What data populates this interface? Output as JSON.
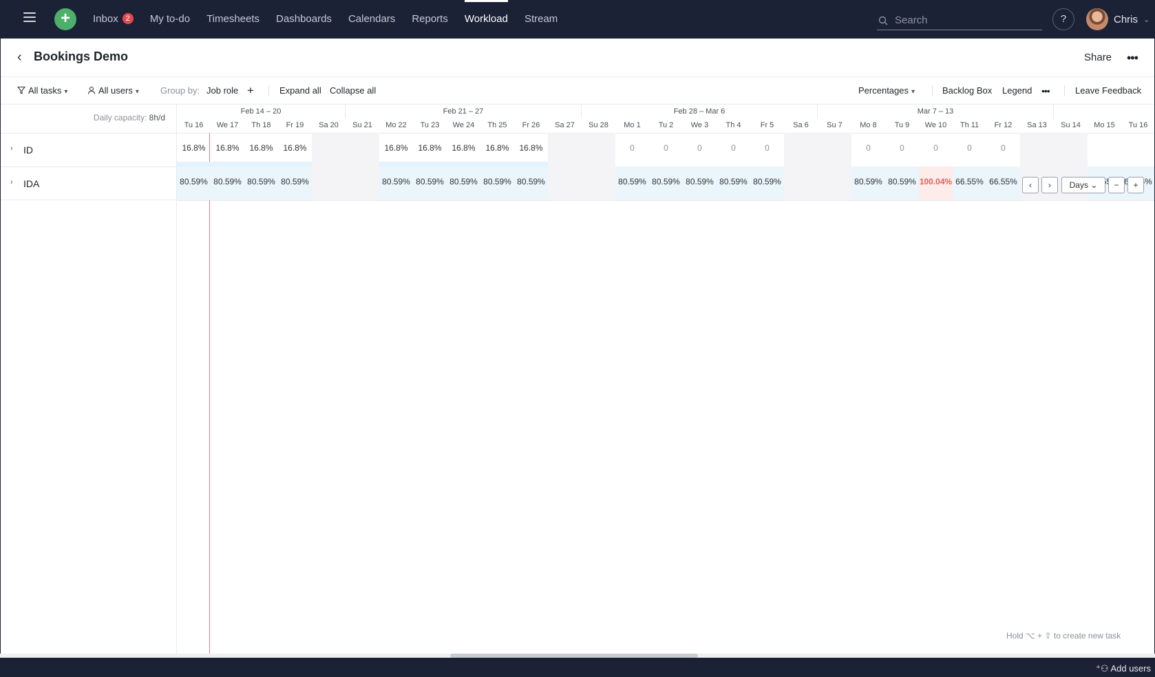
{
  "nav": {
    "inbox": "Inbox",
    "inbox_count": "2",
    "links": [
      "My to-do",
      "Timesheets",
      "Dashboards",
      "Calendars",
      "Reports",
      "Workload",
      "Stream"
    ],
    "active": "Workload",
    "search_placeholder": "Search",
    "help": "?",
    "user": "Chris"
  },
  "title": {
    "text": "Bookings Demo",
    "share": "Share"
  },
  "toolbar": {
    "all_tasks": "All tasks",
    "all_users": "All users",
    "group_by_label": "Group by:",
    "group_by_value": "Job role",
    "add": "+",
    "expand_all": "Expand all",
    "collapse_all": "Collapse all",
    "percentages": "Percentages",
    "backlog_box": "Backlog Box",
    "legend": "Legend",
    "leave_feedback": "Leave Feedback"
  },
  "grid": {
    "capacity_label": "Daily capacity:",
    "capacity_value": "8h/d",
    "weeks": [
      "Feb 14 – 20",
      "Feb 21 – 27",
      "Feb 28 – Mar 6",
      "Mar 7 – 13"
    ],
    "days": [
      "Tu 16",
      "We 17",
      "Th 18",
      "Fr 19",
      "Sa 20",
      "Su 21",
      "Mo 22",
      "Tu 23",
      "We 24",
      "Th 25",
      "Fr 26",
      "Sa 27",
      "Su 28",
      "Mo 1",
      "Tu 2",
      "We 3",
      "Th 4",
      "Fr 5",
      "Sa 6",
      "Su 7",
      "Mo 8",
      "Tu 9",
      "We 10",
      "Th 11",
      "Fr 12",
      "Sa 13",
      "Su 14",
      "Mo 15",
      "Tu 16"
    ],
    "rows": [
      {
        "label": "ID",
        "cells": [
          "16.8%",
          "16.8%",
          "16.8%",
          "16.8%",
          "",
          "",
          "16.8%",
          "16.8%",
          "16.8%",
          "16.8%",
          "16.8%",
          "",
          "",
          "0",
          "0",
          "0",
          "0",
          "0",
          "",
          "",
          "0",
          "0",
          "0",
          "0",
          "0",
          "",
          "",
          "",
          ""
        ]
      },
      {
        "label": "IDA",
        "cells": [
          "80.59%",
          "80.59%",
          "80.59%",
          "80.59%",
          "",
          "",
          "80.59%",
          "80.59%",
          "80.59%",
          "80.59%",
          "80.59%",
          "",
          "",
          "80.59%",
          "80.59%",
          "80.59%",
          "80.59%",
          "80.59%",
          "",
          "",
          "80.59%",
          "80.59%",
          "100.04%",
          "66.55%",
          "66.55%",
          "",
          "",
          "66.55%",
          "66.55%"
        ]
      }
    ],
    "view_mode": "Days"
  },
  "hint": "Hold ⌥ + ⇧ to create new task",
  "add_users": "Add users"
}
